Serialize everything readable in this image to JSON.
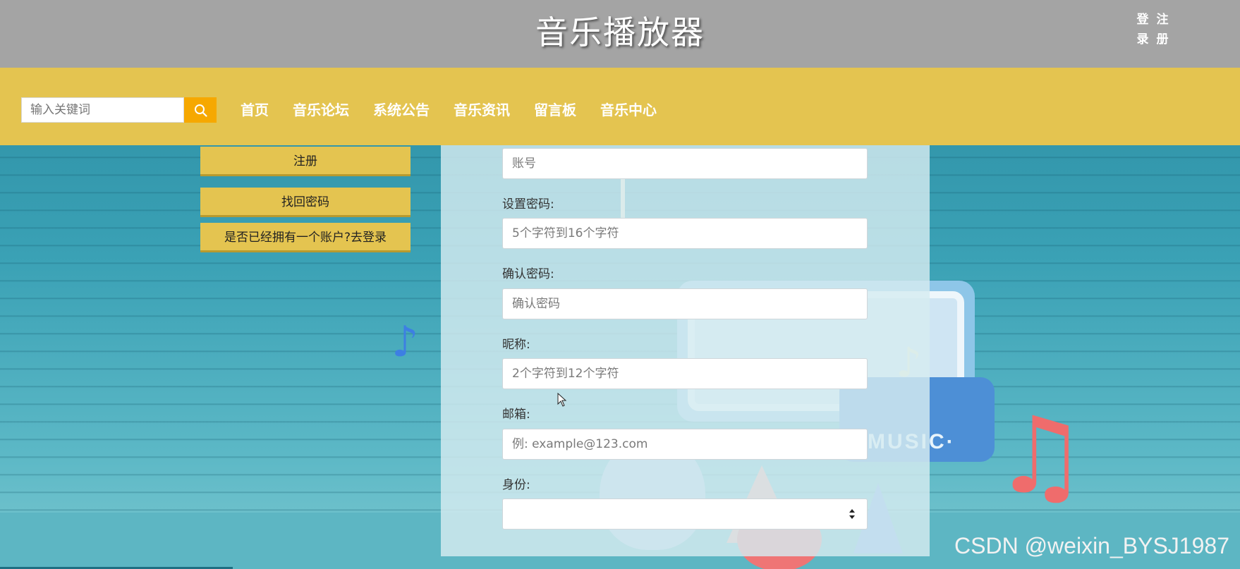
{
  "header": {
    "site_title": "音乐播放器",
    "login_label": "登录",
    "register_label": "注册"
  },
  "navbar": {
    "search": {
      "placeholder": "输入关键词",
      "icon": "search-icon"
    },
    "items": [
      "首页",
      "音乐论坛",
      "系统公告",
      "音乐资讯",
      "留言板",
      "音乐中心"
    ]
  },
  "sidebar": {
    "register_button": "注册",
    "recover_password_button": "找回密码",
    "go_login_button": "是否已经拥有一个账户?去登录"
  },
  "form": {
    "account": {
      "placeholder": "账号"
    },
    "password": {
      "label": "设置密码:",
      "placeholder": "5个字符到16个字符"
    },
    "confirm_password": {
      "label": "确认密码:",
      "placeholder": "确认密码"
    },
    "nickname": {
      "label": "昵称:",
      "placeholder": "2个字符到12个字符"
    },
    "email": {
      "label": "邮箱:",
      "placeholder": "例: example@123.com"
    },
    "role": {
      "label": "身份:",
      "selected": ""
    }
  },
  "background": {
    "monitor_text": "MUSIC·"
  },
  "watermark": "CSDN @weixin_BYSJ1987",
  "colors": {
    "header_bg": "#a4a4a4",
    "navbar_bg": "#e4c450",
    "search_button": "#f6a800",
    "side_button": "#e4c450"
  }
}
